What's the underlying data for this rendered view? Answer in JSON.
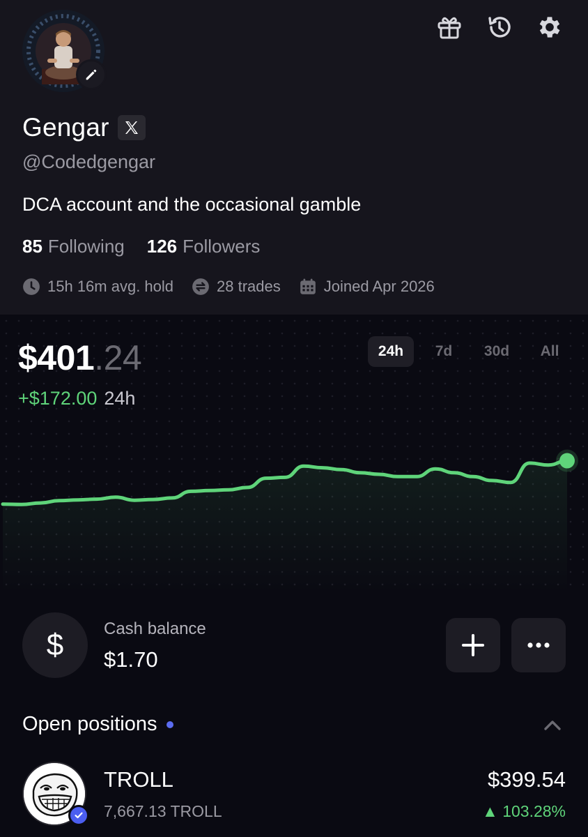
{
  "profile": {
    "name": "Gengar",
    "handle": "@Codedgengar",
    "bio": "DCA account and the occasional gamble",
    "following_count": "85",
    "following_label": "Following",
    "followers_count": "126",
    "followers_label": "Followers",
    "avg_hold": "15h 16m avg. hold",
    "trades": "28 trades",
    "joined": "Joined Apr 2026"
  },
  "portfolio": {
    "balance_whole": "$401",
    "balance_cents": ".24",
    "change_amount": "+$172.00",
    "change_period": "24h",
    "ranges": [
      "24h",
      "7d",
      "30d",
      "All"
    ],
    "active_range": "24h"
  },
  "chart_data": {
    "type": "line",
    "title": "",
    "xlabel": "",
    "ylabel": "",
    "ylim": [
      0,
      450
    ],
    "grid": true,
    "line_color": "#5fd47a",
    "series": [
      {
        "values": [
          229,
          228,
          232,
          238,
          240,
          242,
          247,
          239,
          241,
          245,
          262,
          264,
          266,
          272,
          296,
          298,
          327,
          323,
          318,
          310,
          306,
          300,
          300,
          320,
          310,
          300,
          290,
          285,
          335,
          330,
          341
        ]
      }
    ]
  },
  "cash": {
    "label": "Cash balance",
    "amount": "$1.70",
    "currency_symbol": "$"
  },
  "positions": {
    "title": "Open positions",
    "items": [
      {
        "symbol": "TROLL",
        "quantity": "7,667.13 TROLL",
        "value": "$399.54",
        "change": "▲ 103.28%"
      }
    ]
  },
  "icons": {
    "gift": "gift-icon",
    "history": "history-icon",
    "settings": "gear-icon",
    "edit": "pencil-icon",
    "x_logo": "x-logo-icon"
  },
  "colors": {
    "positive": "#5fd47a",
    "accent_blue": "#5b6cf0",
    "background": "#0a0a12",
    "profile_bg": "#16151d"
  }
}
